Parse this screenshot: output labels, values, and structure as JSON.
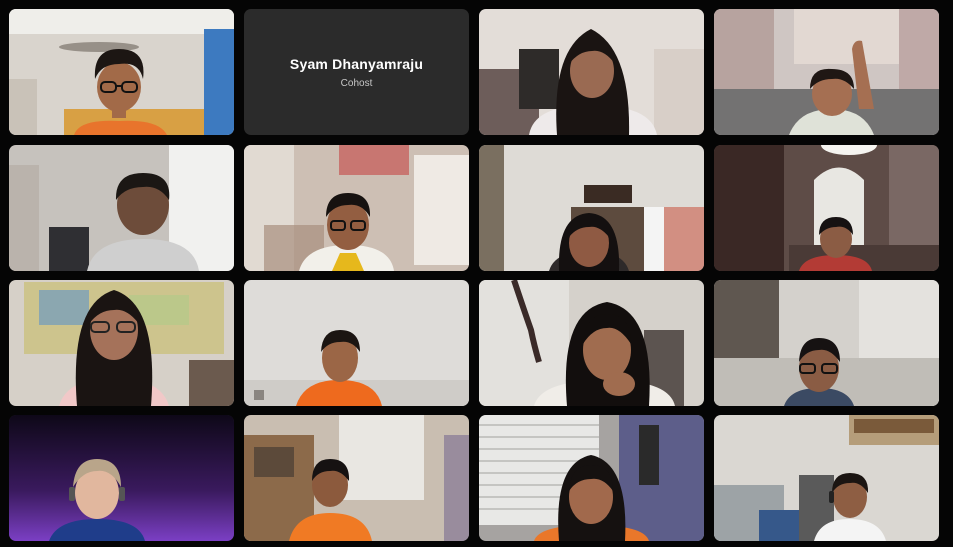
{
  "grid": {
    "tiles": [
      {
        "id": "p1",
        "kind": "camera",
        "bg": "#c9c2b8",
        "shirt": "#e8742c",
        "skin": "#a26a48",
        "hair": "#1c1613",
        "glasses": true
      },
      {
        "id": "p2",
        "kind": "name_card",
        "name": "Syam Dhanyamraju",
        "role": "Cohost"
      },
      {
        "id": "p3",
        "kind": "camera",
        "bg": "#d8d3cf",
        "shirt": "#eeeaea",
        "skin": "#9a6a52",
        "hair": "#1a1412",
        "glasses": false
      },
      {
        "id": "p4",
        "kind": "camera",
        "bg": "#c7b9b8",
        "shirt": "#dfe2d8",
        "skin": "#a56f52",
        "hair": "#1f1714",
        "glasses": false
      },
      {
        "id": "p5",
        "kind": "camera",
        "bg": "#bdbab6",
        "shirt": "#cfcfcf",
        "skin": "#6d4c3a",
        "hair": "#1b1714",
        "glasses": false
      },
      {
        "id": "p6",
        "kind": "camera",
        "bg": "#c9bdb2",
        "shirt": "#f2f0ea",
        "skin": "#935e41",
        "hair": "#171210",
        "glasses": true
      },
      {
        "id": "p7",
        "kind": "camera",
        "bg": "#cdcac4",
        "shirt": "#2e2a2a",
        "skin": "#8f5a43",
        "hair": "#141010",
        "glasses": false
      },
      {
        "id": "p8",
        "kind": "camera",
        "bg": "#6a5a55",
        "shirt": "#b33b35",
        "skin": "#8b5c44",
        "hair": "#161212",
        "glasses": false
      },
      {
        "id": "p9",
        "kind": "camera",
        "bg": "#cec7bf",
        "shirt": "#f1c8c8",
        "skin": "#a5725a",
        "hair": "#1a1412",
        "glasses": true
      },
      {
        "id": "p10",
        "kind": "camera",
        "bg": "#d6d4d1",
        "shirt": "#ee6a1e",
        "skin": "#9b6646",
        "hair": "#1b1512",
        "glasses": false
      },
      {
        "id": "p11",
        "kind": "camera",
        "bg": "#c8c3bd",
        "shirt": "#f0ede8",
        "skin": "#a06c4f",
        "hair": "#120e0d",
        "glasses": false
      },
      {
        "id": "p12",
        "kind": "camera",
        "bg": "#c6c3be",
        "shirt": "#3b4a63",
        "skin": "#8a5c44",
        "hair": "#161212",
        "glasses": true
      },
      {
        "id": "p13",
        "kind": "camera",
        "bg": "#2c1448",
        "shirt": "#1f3d8a",
        "skin": "#e1b79e",
        "hair": "#b9a58a",
        "glasses": false
      },
      {
        "id": "p14",
        "kind": "camera",
        "bg": "#b9ab9c",
        "shirt": "#f07a24",
        "skin": "#8c5a3d",
        "hair": "#161212",
        "glasses": false
      },
      {
        "id": "p15",
        "kind": "camera",
        "bg": "#a9a6a5",
        "shirt": "#e9772a",
        "skin": "#a1694c",
        "hair": "#151110",
        "glasses": false
      },
      {
        "id": "p16",
        "kind": "camera",
        "bg": "#d5d2cd",
        "shirt": "#f4f4f4",
        "skin": "#8e5e43",
        "hair": "#1b1512",
        "glasses": false
      }
    ]
  }
}
